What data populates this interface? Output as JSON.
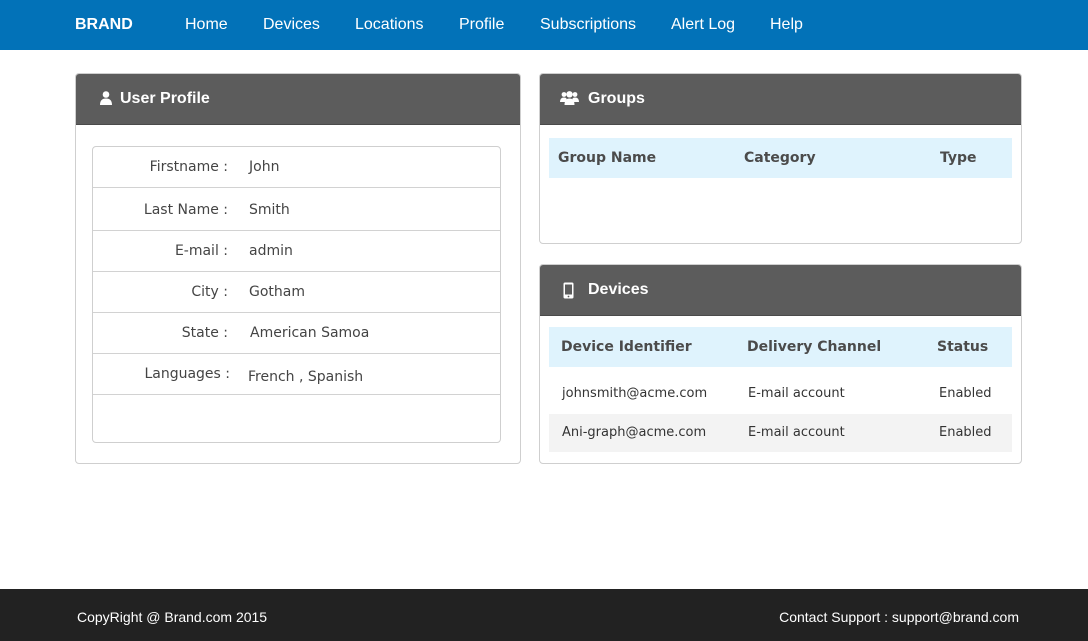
{
  "navbar": {
    "brand": "BRAND",
    "links": [
      "Home",
      "Devices",
      "Locations",
      "Profile",
      "Subscriptions",
      "Alert Log",
      "Help"
    ]
  },
  "user_profile": {
    "title": "User Profile",
    "icon": "user-icon",
    "rows": [
      {
        "label": "Firstname :",
        "value": "John"
      },
      {
        "label": "Last Name :",
        "value": "Smith"
      },
      {
        "label": "E-mail :",
        "value": "admin"
      },
      {
        "label": "City :",
        "value": "Gotham"
      },
      {
        "label": "State :",
        "value": "American Samoa"
      },
      {
        "label": "Languages :",
        "value": "French , Spanish"
      }
    ]
  },
  "groups": {
    "title": "Groups",
    "icon": "users-icon",
    "columns": [
      "Group Name",
      "Category",
      "Type"
    ],
    "rows": []
  },
  "devices": {
    "title": "Devices",
    "icon": "mobile-phone-icon",
    "columns": [
      "Device Identifier",
      "Delivery Channel",
      "Status"
    ],
    "rows": [
      {
        "identifier": "johnsmith@acme.com",
        "channel": "E-mail account",
        "status": "Enabled"
      },
      {
        "identifier": "Ani-graph@acme.com",
        "channel": "E-mail account",
        "status": "Enabled"
      }
    ]
  },
  "footer": {
    "copyright": "CopyRight @ Brand.com 2015",
    "support": "Contact Support : support@brand.com"
  },
  "colors": {
    "navbar": "#0272b8",
    "panel_heading": "#5c5c5c",
    "table_header": "#dff3fd",
    "footer": "#222222"
  }
}
